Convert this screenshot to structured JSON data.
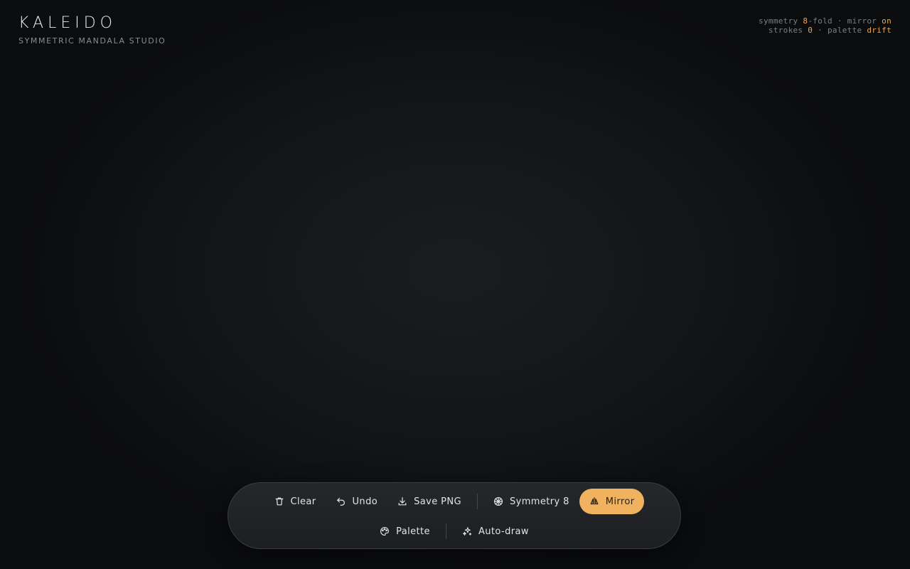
{
  "brand": {
    "title": "KALEIDO",
    "subtitle": "SYMMETRIC MANDALA STUDIO"
  },
  "status": {
    "symmetry_label": "symmetry ",
    "symmetry_value": "8",
    "fold_label": "-fold · mirror ",
    "mirror_value": "on",
    "strokes_label": "strokes ",
    "strokes_value": "0",
    "palette_label": " · palette ",
    "palette_value": "drift"
  },
  "toolbar": {
    "clear": {
      "label": "Clear",
      "icon": "trash-icon"
    },
    "undo": {
      "label": "Undo",
      "icon": "undo-icon"
    },
    "save": {
      "label": "Save PNG",
      "icon": "download-icon"
    },
    "symmetry": {
      "label": "Symmetry 8",
      "icon": "symmetry-icon"
    },
    "mirror": {
      "label": "Mirror",
      "icon": "mirror-icon",
      "active": true
    },
    "palette": {
      "label": "Palette",
      "icon": "palette-icon"
    },
    "autodraw": {
      "label": "Auto-draw",
      "icon": "sparkles-icon"
    }
  },
  "colors": {
    "accent": "#f0b25e",
    "status_accent": "#e9a85a",
    "background": "#131518"
  }
}
